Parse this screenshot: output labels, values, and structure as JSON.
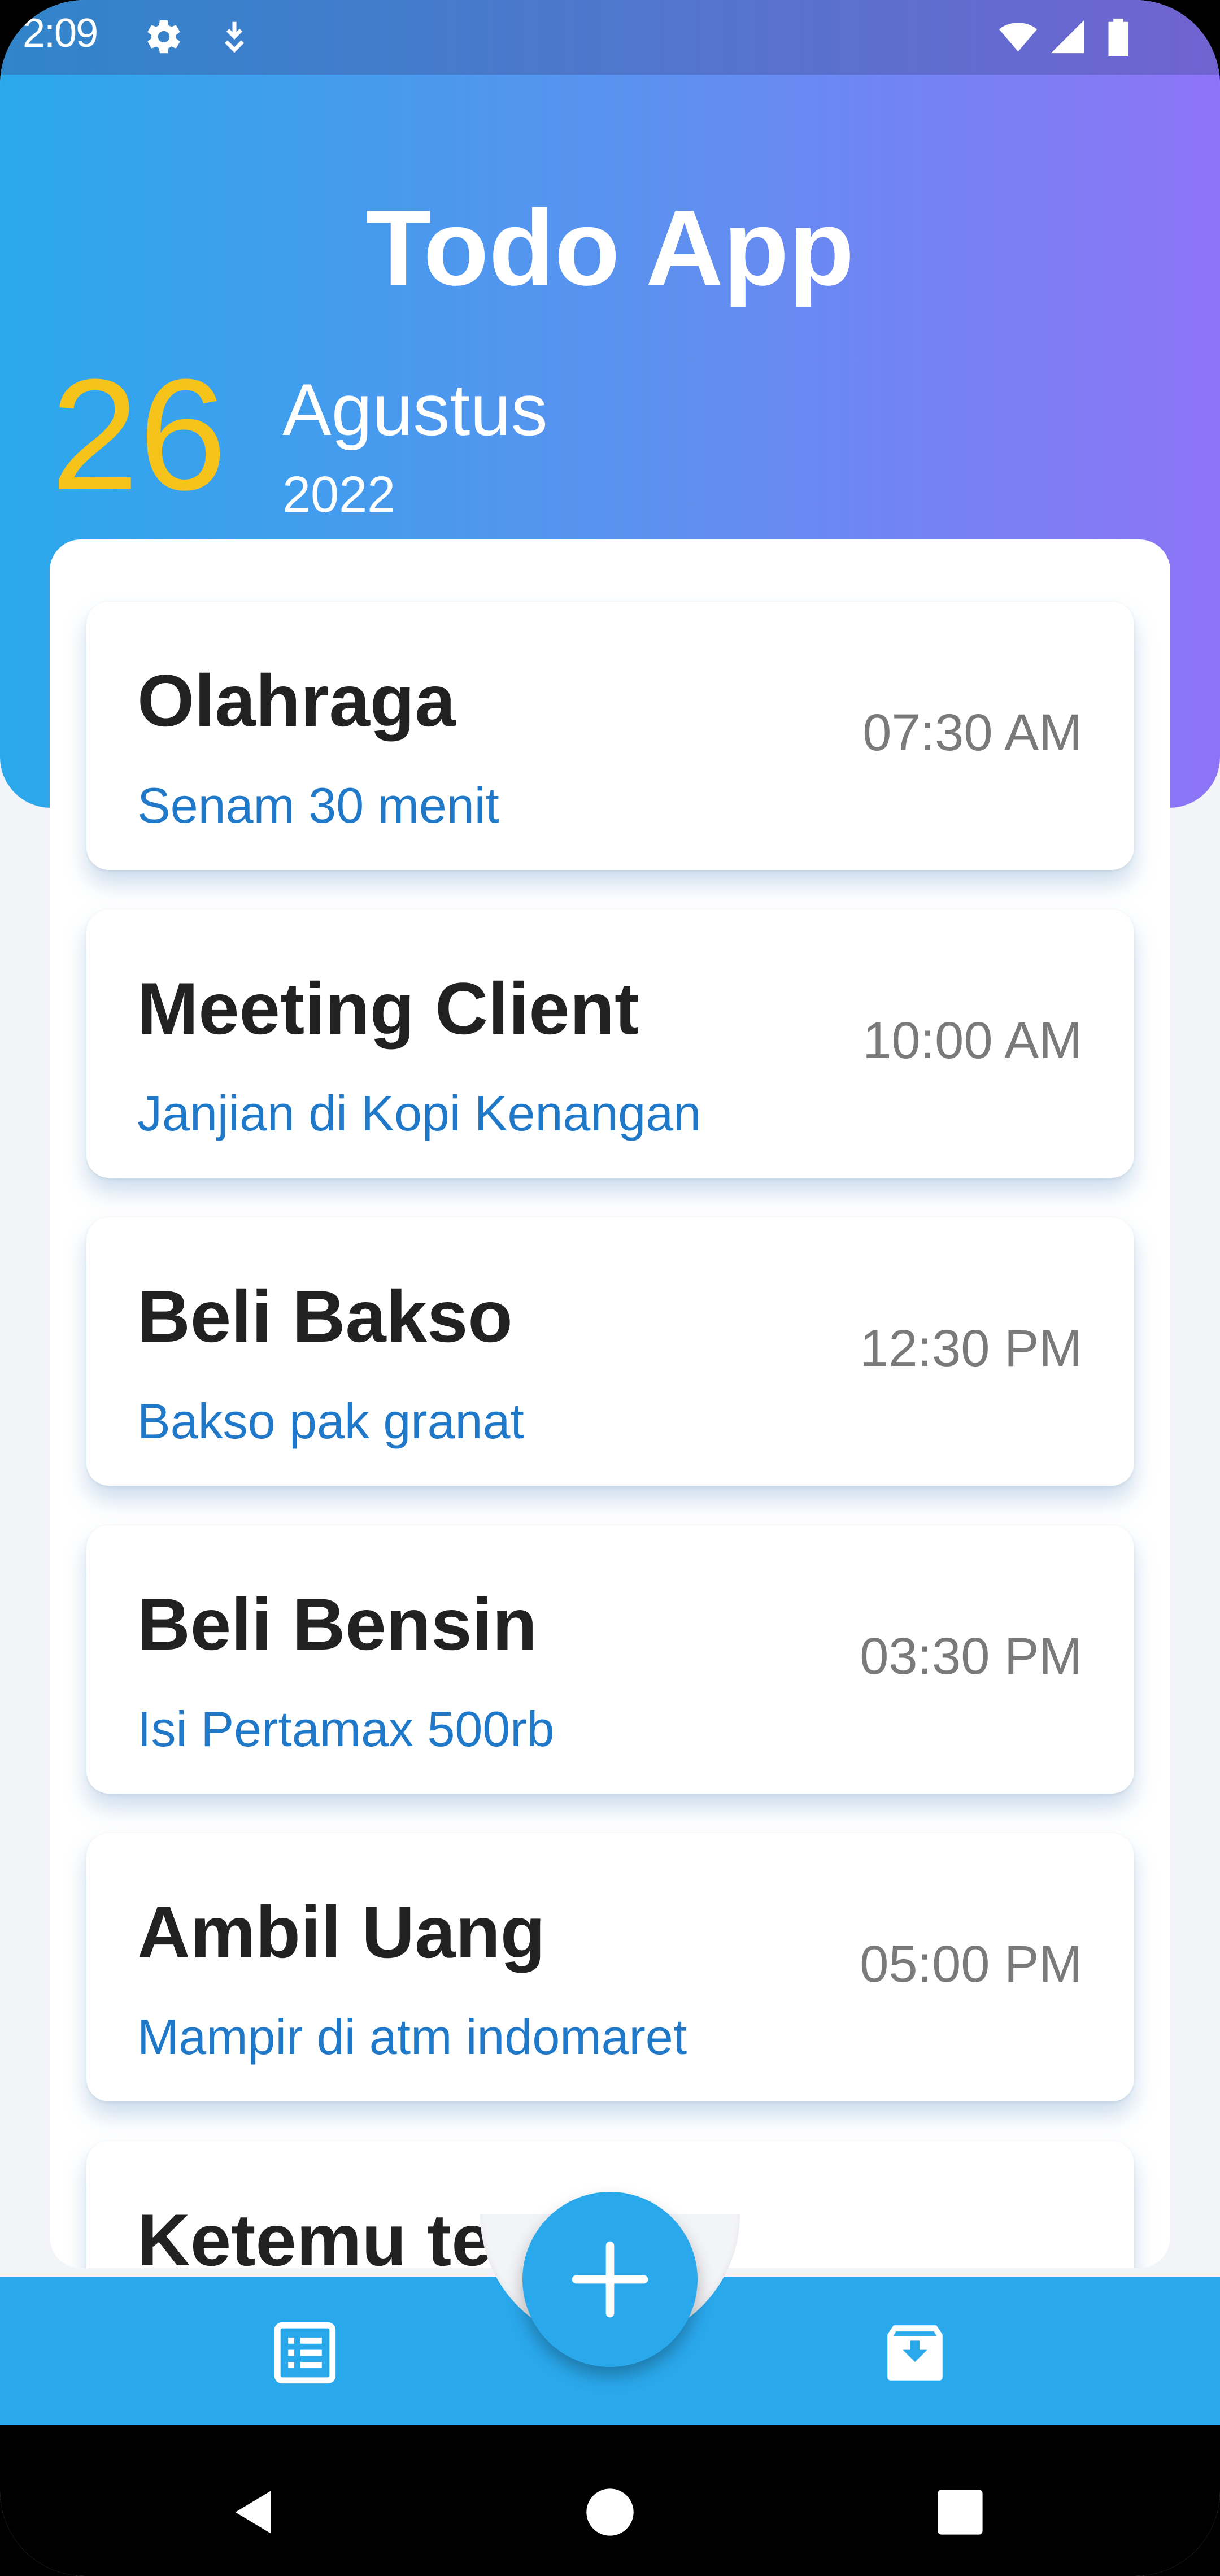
{
  "status_bar": {
    "time": "2:09",
    "icons": [
      "gear-icon",
      "download-icon",
      "wifi-icon",
      "signal-icon",
      "battery-icon"
    ]
  },
  "header": {
    "title": "Todo App",
    "day": "26",
    "month": "Agustus",
    "year": "2022"
  },
  "colors": {
    "gradient_start": "#2aa8ec",
    "gradient_end": "#8d74f6",
    "day_accent": "#f6c31b",
    "description": "#1f78c8",
    "primary": "#2aa8ec"
  },
  "tasks": [
    {
      "title": "Olahraga",
      "description": "Senam 30 menit",
      "time": "07:30 AM"
    },
    {
      "title": "Meeting Client",
      "description": "Janjian di Kopi Kenangan",
      "time": "10:00 AM"
    },
    {
      "title": "Beli Bakso",
      "description": "Bakso pak granat",
      "time": "12:30 PM"
    },
    {
      "title": "Beli Bensin",
      "description": "Isi Pertamax 500rb",
      "time": "03:30 PM"
    },
    {
      "title": "Ambil Uang",
      "description": "Mampir di atm indomaret",
      "time": "05:00 PM"
    },
    {
      "title": "Ketemu tem",
      "description": "",
      "time": ""
    }
  ],
  "bottom_nav": {
    "left_icon": "list-icon",
    "fab_icon": "plus-icon",
    "right_icon": "archive-icon"
  },
  "system_nav": [
    "back-icon",
    "home-icon",
    "recents-icon"
  ]
}
